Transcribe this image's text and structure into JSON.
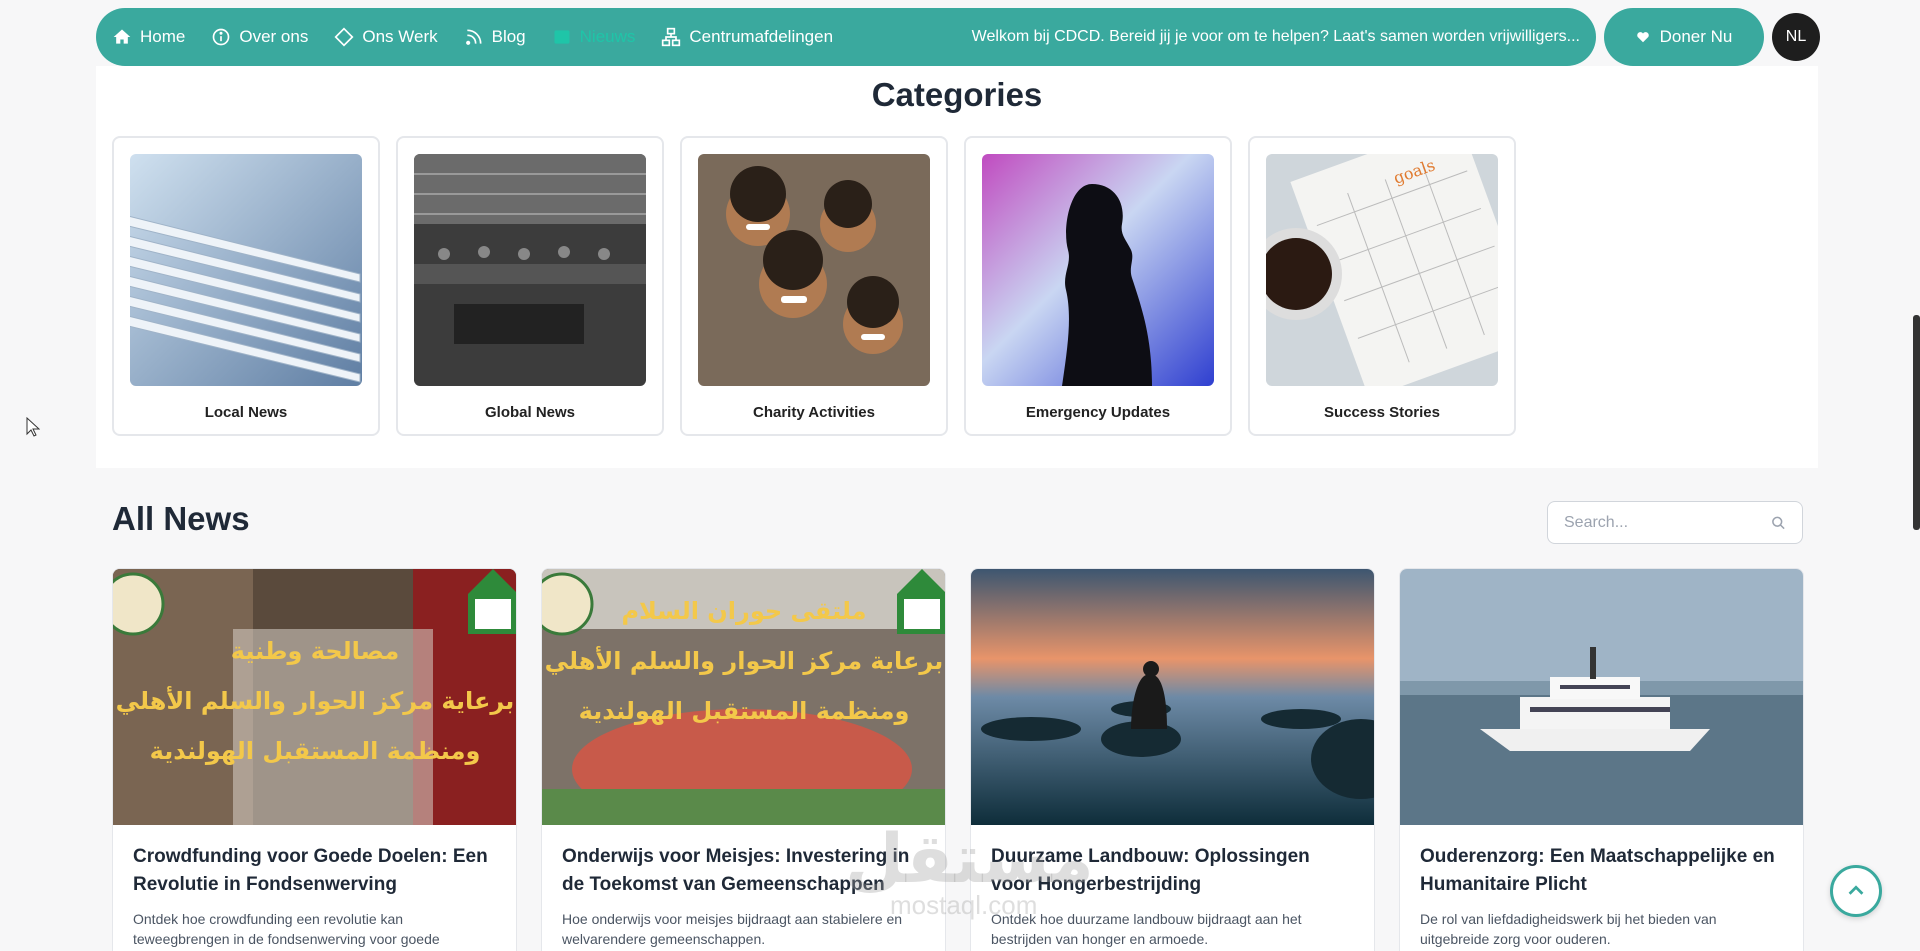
{
  "nav": {
    "items": [
      {
        "label": "Home",
        "icon": "home-icon"
      },
      {
        "label": "Over ons",
        "icon": "info-icon"
      },
      {
        "label": "Ons Werk",
        "icon": "diamond-icon"
      },
      {
        "label": "Blog",
        "icon": "blog-icon"
      },
      {
        "label": "Nieuws",
        "icon": "news-icon",
        "active": true
      },
      {
        "label": "Centrumafdelingen",
        "icon": "departments-icon"
      }
    ],
    "ticker": "Welkom bij CDCD. Bereid jij je voor om te helpen? Laat's samen worden vrijwilligers...",
    "donate_label": "Doner Nu",
    "lang_label": "NL"
  },
  "categories": {
    "title": "Categories",
    "items": [
      {
        "label": "Local News"
      },
      {
        "label": "Global News"
      },
      {
        "label": "Charity Activities"
      },
      {
        "label": "Emergency Updates"
      },
      {
        "label": "Success Stories"
      }
    ]
  },
  "news": {
    "title": "All News",
    "search_placeholder": "Search...",
    "articles": [
      {
        "title": "Crowdfunding voor Goede Doelen: Een Revolutie in Fondsenwerving",
        "excerpt": "Ontdek hoe crowdfunding een revolutie kan teweegbrengen in de fondsenwerving voor goede",
        "image_text": [
          "مصالحة وطنية",
          "برعاية مركز الحوار والسلم الأهلي",
          "ومنظمة المستقبل الهولندية"
        ]
      },
      {
        "title": "Onderwijs voor Meisjes: Investering in de Toekomst van Gemeenschappen",
        "excerpt": "Hoe onderwijs voor meisjes bijdraagt aan stabielere en welvarendere gemeenschappen.",
        "image_text": [
          "ملتقى حوران السلام",
          "برعاية مركز الحوار والسلم الأهلي",
          "ومنظمة المستقبل الهولندية"
        ]
      },
      {
        "title": "Duurzame Landbouw: Oplossingen voor Hongerbestrijding",
        "excerpt": "Ontdek hoe duurzame landbouw bijdraagt aan het bestrijden van honger en armoede."
      },
      {
        "title": "Ouderenzorg: Een Maatschappelijke en Humanitaire Plicht",
        "excerpt": "De rol van liefdadigheidswerk bij het bieden van uitgebreide zorg voor ouderen."
      }
    ]
  },
  "watermark": {
    "text": "مستقل",
    "sub": "mostaql.com"
  },
  "colors": {
    "brand": "#3aa99e",
    "active": "#1fc5a8",
    "dark": "#1e1e1e"
  }
}
